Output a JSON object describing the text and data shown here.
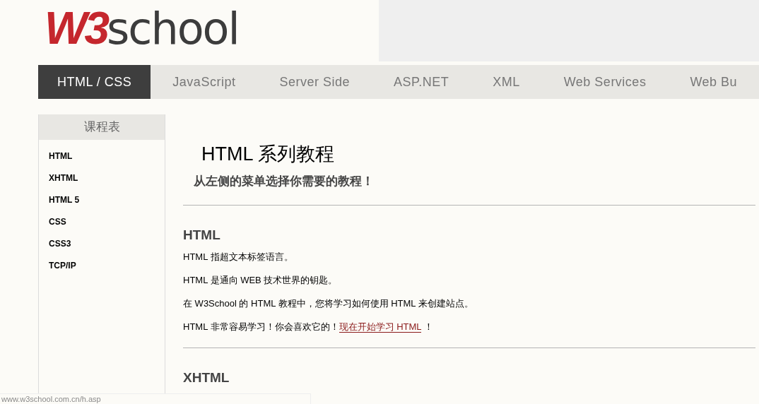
{
  "logo": {
    "red_part": "W3",
    "dark_part": "school"
  },
  "nav_tabs": [
    {
      "label": "HTML / CSS",
      "selected": true
    },
    {
      "label": "JavaScript",
      "selected": false
    },
    {
      "label": "Server Side",
      "selected": false
    },
    {
      "label": "ASP.NET",
      "selected": false
    },
    {
      "label": "XML",
      "selected": false
    },
    {
      "label": "Web Services",
      "selected": false
    },
    {
      "label": "Web Bu",
      "selected": false
    }
  ],
  "sidebar": {
    "title": "课程表",
    "items": [
      "HTML",
      "XHTML",
      "HTML 5",
      "CSS",
      "CSS3",
      "TCP/IP"
    ]
  },
  "main": {
    "title": "HTML 系列教程",
    "subtitle": "从左侧的菜单选择你需要的教程！",
    "sections": [
      {
        "heading": "HTML",
        "paragraphs": [
          {
            "text": "HTML 指超文本标签语言。"
          },
          {
            "text": "HTML 是通向 WEB 技术世界的钥匙。"
          },
          {
            "text": "在 W3School 的 HTML 教程中，您将学习如何使用 HTML 来创建站点。"
          },
          {
            "text": "HTML 非常容易学习！你会喜欢它的！",
            "link": "现在开始学习 HTML",
            "after": " ！"
          }
        ]
      },
      {
        "heading": "XHTML"
      }
    ]
  },
  "status_url": "www.w3school.com.cn/h.asp"
}
